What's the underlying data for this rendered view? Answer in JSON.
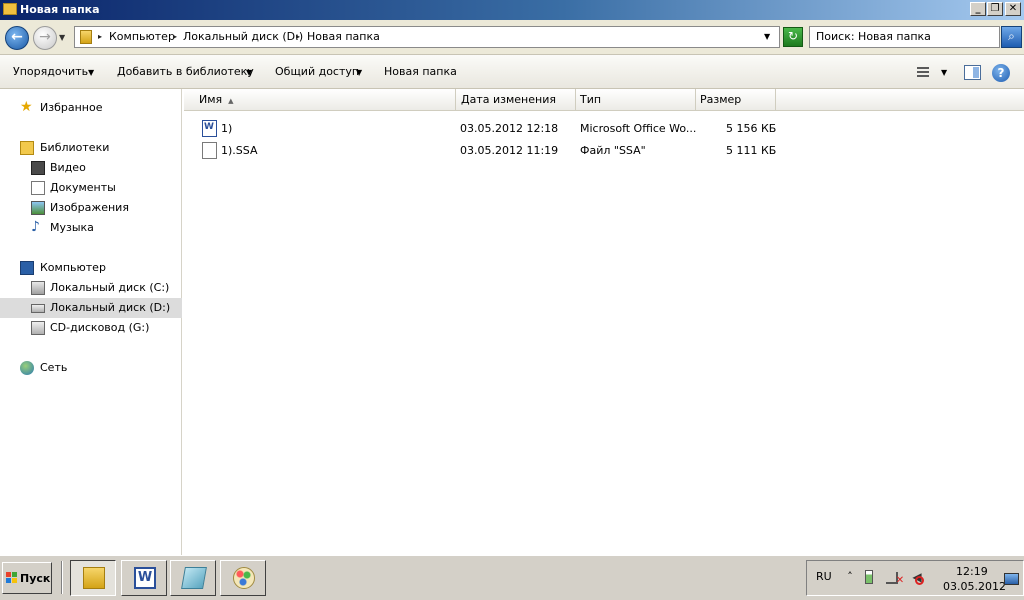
{
  "window": {
    "title": "Новая папка",
    "minimize_glyph": "_",
    "maximize_glyph": "❐",
    "close_glyph": "✕"
  },
  "nav": {
    "back_glyph": "←",
    "forward_glyph": "→",
    "history_glyph": "▼"
  },
  "address": {
    "separator": "▸",
    "breadcrumbs": [
      "Компьютер",
      "Локальный диск (D:)",
      "Новая папка"
    ],
    "dropdown_glyph": "▼",
    "refresh_glyph": "↻"
  },
  "search": {
    "value": "Поиск: Новая папка",
    "button_glyph": "⌕"
  },
  "toolbar": {
    "organize": "Упорядочить",
    "add_to_library": "Добавить в библиотеку",
    "share": "Общий доступ",
    "new_folder": "Новая папка",
    "dropdown_glyph": "▼",
    "help_glyph": "?"
  },
  "sidebar": {
    "favorites": "Избранное",
    "libraries": "Библиотеки",
    "video": "Видео",
    "documents": "Документы",
    "pictures": "Изображения",
    "music": "Музыка",
    "computer": "Компьютер",
    "disk_c": "Локальный диск (C:)",
    "disk_d": "Локальный диск (D:)",
    "cd": "CD-дисковод (G:)",
    "network": "Сеть"
  },
  "columns": {
    "name": "Имя",
    "sort_glyph": "▲",
    "date": "Дата изменения",
    "type": "Тип",
    "size": "Размер"
  },
  "files": [
    {
      "name": "1)",
      "date": "03.05.2012 12:18",
      "type": "Microsoft Office Wo...",
      "size": "5 156 КБ",
      "icon": "word-document-icon"
    },
    {
      "name": "1).SSA",
      "date": "03.05.2012 11:19",
      "type": "Файл \"SSA\"",
      "size": "5 111 КБ",
      "icon": "generic-file-icon"
    }
  ],
  "taskbar": {
    "start": "Пуск",
    "lang": "RU",
    "tray_up_glyph": "˄",
    "time": "12:19",
    "date": "03.05.2012"
  },
  "colors": {
    "title_gradient_start": "#0a246a",
    "title_gradient_end": "#a6caf0",
    "selected_row": "#dcdcdc",
    "chrome": "#d4d0c8"
  }
}
